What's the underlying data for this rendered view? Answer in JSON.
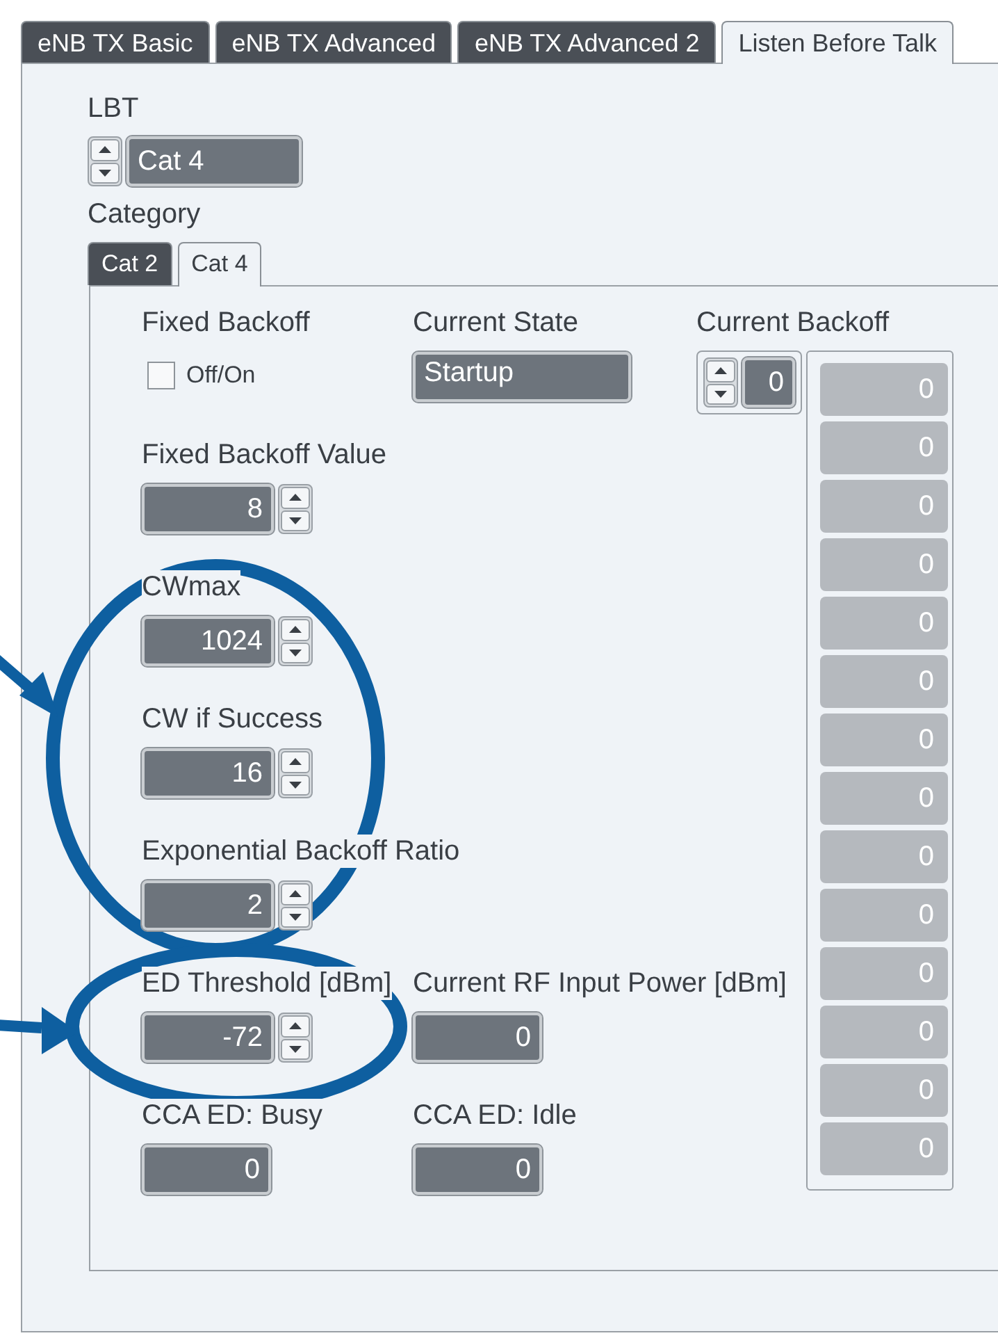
{
  "tabs": [
    {
      "label": "eNB TX Basic",
      "selected": false
    },
    {
      "label": "eNB TX Advanced",
      "selected": false
    },
    {
      "label": "eNB TX Advanced 2",
      "selected": false
    },
    {
      "label": "Listen Before Talk",
      "selected": true
    }
  ],
  "lbt": {
    "label": "LBT",
    "value": "Cat 4",
    "caption": "Category"
  },
  "category_tabs": [
    {
      "label": "Cat 2",
      "selected": false
    },
    {
      "label": "Cat 4",
      "selected": true
    }
  ],
  "rows": [
    {
      "cells": [
        {
          "kind": "checkbox",
          "label": "Fixed Backoff",
          "option": "Off/On",
          "checked": false
        },
        {
          "kind": "status",
          "label": "Current State",
          "value": "Startup"
        }
      ]
    },
    {
      "cells": [
        {
          "kind": "spinner",
          "label": "Fixed Backoff Value",
          "value": "8"
        }
      ]
    },
    {
      "cells": [
        {
          "kind": "spinner",
          "label": "CWmax",
          "value": "1024"
        }
      ]
    },
    {
      "cells": [
        {
          "kind": "spinner",
          "label": "CW if Success",
          "value": "16"
        }
      ]
    },
    {
      "cells": [
        {
          "kind": "spinner",
          "label": "Exponential Backoff Ratio",
          "value": "2"
        }
      ]
    },
    {
      "cells": [
        {
          "kind": "spinner",
          "label": "ED Threshold [dBm]",
          "value": "-72"
        },
        {
          "kind": "display",
          "label": "Current RF Input Power [dBm]",
          "value": "0"
        }
      ]
    },
    {
      "cells": [
        {
          "kind": "display",
          "label": "CCA ED: Busy",
          "value": "0"
        },
        {
          "kind": "display",
          "label": "CCA ED: Idle",
          "value": "0"
        }
      ]
    }
  ],
  "current_backoff": {
    "label": "Current Backoff",
    "value": "0",
    "history": [
      "0",
      "0",
      "0",
      "0",
      "0",
      "0",
      "0",
      "0",
      "0",
      "0",
      "0",
      "0",
      "0",
      "0"
    ]
  }
}
